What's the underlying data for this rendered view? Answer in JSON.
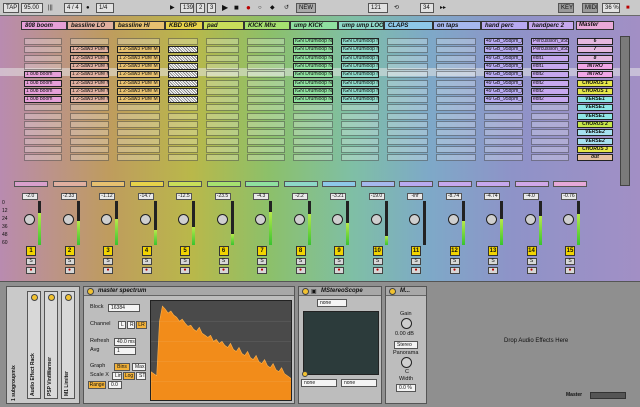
{
  "toolbar": {
    "tap": "TAP",
    "tempo": "95.00",
    "sig": "4 / 4",
    "quant": "1/4",
    "bars": "139",
    "beats": "2",
    "sixteenths": "3",
    "new": "NEW",
    "loop_start": "121",
    "loop_len": "34",
    "key": "KEY",
    "midi": "MIDI",
    "cpu": "36 %"
  },
  "tracks": [
    {
      "name": "808 boom",
      "color": "#e6a0d8",
      "clips": [
        null,
        null,
        null,
        null,
        "1 808 boom",
        "1 808 boom",
        "1 808 boom",
        "1 808 boom"
      ]
    },
    {
      "name": "bassline LO",
      "color": "#e0b0a0",
      "clips": [
        null,
        "1 2-Saw3 Pure M",
        "1 2-Saw3 Pure M",
        "1 2-Saw3 Pure M",
        "1 2-Saw3 Pure M",
        "1 2-Saw3 Pure M",
        "1 2-Saw3 Pure M",
        "1 2-Saw3 Pure M"
      ]
    },
    {
      "name": "bassline HI",
      "color": "#e6c070",
      "clips": [
        null,
        "1 2-Saw3 Pure M",
        "1 2-Saw3 Pure M",
        "1 2-Saw3 Pure M",
        "1 2-Saw3 Pure M",
        "1 2-Saw3 Pure M",
        "1 2-Saw3 Pure M",
        "1 2-Saw3 Pure M"
      ]
    },
    {
      "name": "KBD GRP",
      "color": "#e6d24a",
      "clips": [
        null,
        "",
        "",
        "",
        "",
        "",
        "",
        ""
      ]
    },
    {
      "name": "pad",
      "color": "#c9de5a",
      "clips": [
        null,
        null,
        null,
        null,
        null,
        null,
        null,
        null
      ]
    },
    {
      "name": "KICK Mhz",
      "color": "#a6e070",
      "clips": [
        null,
        null,
        null,
        null,
        null,
        null,
        null,
        null
      ]
    },
    {
      "name": "ump KICK",
      "color": "#8fe0a0",
      "clips": [
        "IGN Drumloop N",
        "IGN Drumloop N",
        "IGN Drumloop N",
        "IGN Drumloop N",
        "IGN Drumloop N",
        "IGN Drumloop N",
        "IGN Drumloop N",
        "IGN Drumloop N"
      ]
    },
    {
      "name": "ump ump LOOP",
      "color": "#8ed8c8",
      "clips": [
        "IGN Drumloop N",
        "IGN Drumloop N",
        "IGN Drumloop N",
        "IGN Drumloop N",
        "IGN Drumloop N",
        "IGN Drumloop N",
        "IGN Drumloop N",
        "IGN Drumloop N"
      ]
    },
    {
      "name": "CLAPS",
      "color": "#8ec8e8",
      "clips": [
        null,
        null,
        null,
        null,
        null,
        null,
        null,
        null
      ]
    },
    {
      "name": "on taps",
      "color": "#a6b8ee",
      "clips": [
        null,
        null,
        null,
        null,
        null,
        null,
        null,
        null
      ]
    },
    {
      "name": "hand perc",
      "color": "#b8aaf0",
      "clips": [
        "49 GB_95bpm_a",
        "49 GB_95bpm_a",
        "49 GB_95bpm_a",
        "49 GB_95bpm_a",
        "49 GB_95bpm_a",
        "49 GB_95bpm_a",
        "49 GB_95bpm_a",
        "49 GB_95bpm_a"
      ]
    },
    {
      "name": "handperc 2",
      "color": "#c6a8ee",
      "clips": [
        "Percussion_95b",
        "Percussion_95b",
        "edit1",
        "edit1",
        "edit2",
        "edit2",
        "edit2",
        "edit2"
      ]
    }
  ],
  "master": {
    "name": "Master",
    "scenes": [
      "6",
      "7",
      "8",
      "INTRO",
      "INTRO",
      "CHORUS 1",
      "CHORUS 1",
      "VERSE1",
      "VERSE1",
      "VERSE1",
      "CHORUS 2",
      "VERSE2",
      "VERSE2",
      "CHORUS 3",
      "out"
    ]
  },
  "mixer": {
    "numbers": [
      "1",
      "2",
      "3",
      "4",
      "5",
      "6",
      "7",
      "8",
      "9",
      "10",
      "11",
      "12",
      "13",
      "14",
      "15"
    ],
    "volumes": [
      "-2.0",
      "-2.33",
      "-1.12",
      "-14.7",
      "-12.5",
      "-23.5",
      "-4.3",
      "-2.2",
      "-3.21",
      "-19.0",
      "-inf",
      "-8.74",
      "-4.74",
      "-4.0",
      "-0.76"
    ],
    "scale": [
      "0",
      "12",
      "24",
      "36",
      "48",
      "60"
    ],
    "solo": "S",
    "arm": "●"
  },
  "devices": {
    "rack_items": [
      "Audio Effect Rack",
      "PSP VintWarmer",
      "M1 Limiter"
    ],
    "rack_side": "1 subgroupmix",
    "spectrum": {
      "title": "master spectrum",
      "block_label": "Block",
      "block": "16384",
      "channel_label": "Channel",
      "ch_l": "L",
      "ch_r": "R",
      "ch_lr": "LR",
      "refresh_label": "Refresh",
      "refresh": "40.0 ms",
      "avg_label": "Avg",
      "avg": "1",
      "graph_label": "Graph",
      "bins": "Bins",
      "max": "Max",
      "scalex_label": "Scale X",
      "lin": "Lin",
      "log": "Log",
      "st": "ST",
      "range": "Range",
      "range_val": "0.0"
    },
    "scope": {
      "title": "MStereoScope",
      "none": "none",
      "none_a": "none",
      "none_b": "none"
    },
    "util": {
      "title": "M...",
      "gain_label": "Gain",
      "gain": "0.00 dB",
      "stereo": "Stereo",
      "panorama_label": "Panorama",
      "pan": "C",
      "width_label": "Width",
      "width": "0.0 %"
    },
    "drop": "Drop Audio Effects Here",
    "master_label": "Master"
  },
  "chart_data": {
    "type": "area",
    "title": "master spectrum",
    "x": [
      0,
      2,
      4,
      6,
      8,
      10,
      12,
      14,
      16,
      18,
      20,
      22,
      24,
      26,
      28,
      30,
      32,
      34,
      36,
      38,
      40,
      42,
      44,
      46,
      48,
      50,
      52,
      54,
      56,
      58,
      60,
      62,
      64,
      66,
      68,
      70,
      72,
      74,
      76,
      78,
      80,
      82,
      84,
      86,
      88,
      90,
      92,
      94,
      96,
      98,
      100
    ],
    "series": [
      {
        "values": [
          30,
          28,
          26,
          80,
          95,
          92,
          88,
          90,
          86,
          84,
          80,
          82,
          78,
          75,
          76,
          72,
          70,
          74,
          68,
          66,
          64,
          66,
          60,
          62,
          58,
          60,
          56,
          54,
          58,
          52,
          50,
          54,
          48,
          46,
          50,
          44,
          42,
          46,
          40,
          38,
          42,
          36,
          34,
          38,
          32,
          30,
          34,
          28,
          26,
          24,
          20
        ]
      }
    ],
    "ylim": [
      0,
      100
    ]
  }
}
